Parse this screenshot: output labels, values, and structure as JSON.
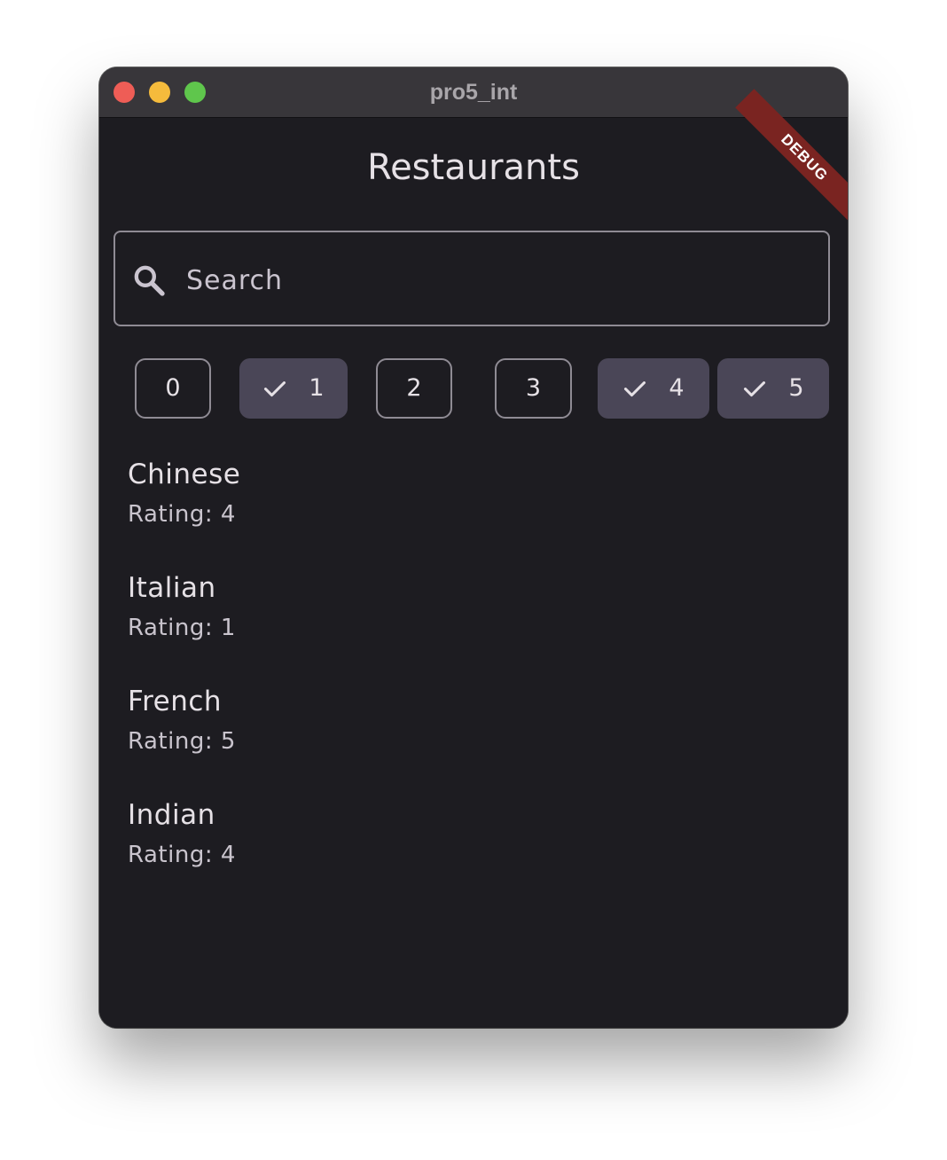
{
  "window": {
    "title": "pro5_int"
  },
  "debug_banner": "DEBUG",
  "page": {
    "title": "Restaurants"
  },
  "search": {
    "placeholder": "Search",
    "value": ""
  },
  "rating_filters": [
    {
      "label": "0",
      "selected": false
    },
    {
      "label": "1",
      "selected": true
    },
    {
      "label": "2",
      "selected": false
    },
    {
      "label": "3",
      "selected": false
    },
    {
      "label": "4",
      "selected": true
    },
    {
      "label": "5",
      "selected": true
    }
  ],
  "restaurants": [
    {
      "name": "Chinese",
      "rating": "Rating: 4"
    },
    {
      "name": "Italian",
      "rating": "Rating: 1"
    },
    {
      "name": "French",
      "rating": "Rating: 5"
    },
    {
      "name": "Indian",
      "rating": "Rating: 4"
    }
  ],
  "colors": {
    "background": "#1d1c21",
    "titlebar": "#38363a",
    "chip_selected": "#4a4657",
    "outline": "#8f8b94",
    "debug_ribbon": "#7a2421"
  },
  "icons": {
    "search": "search-icon",
    "check": "check-icon"
  }
}
